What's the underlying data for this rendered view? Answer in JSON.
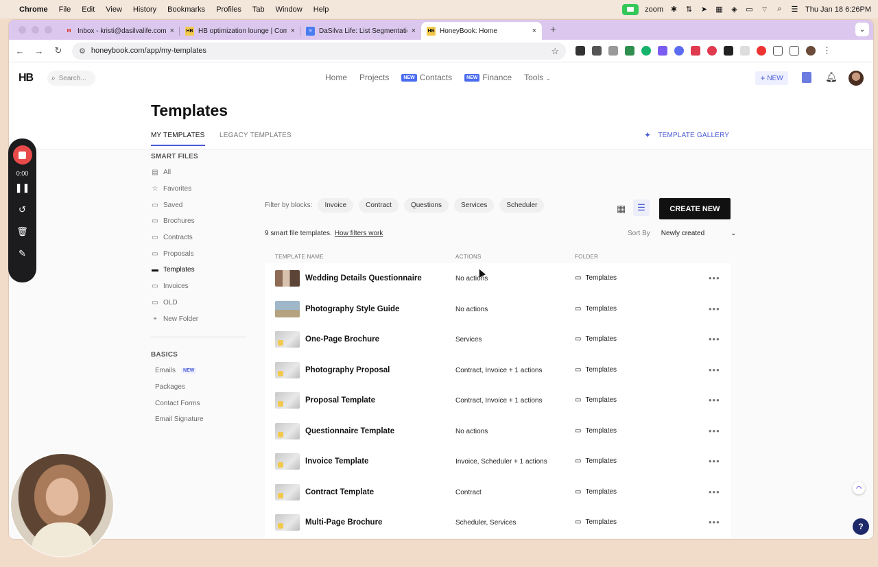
{
  "menubar": {
    "app": "Chrome",
    "items": [
      "File",
      "Edit",
      "View",
      "History",
      "Bookmarks",
      "Profiles",
      "Tab",
      "Window",
      "Help"
    ],
    "zoom_label": "zoom",
    "datetime": "Thu Jan 18  6:26PM"
  },
  "browser": {
    "tabs": [
      {
        "title": "Inbox - kristi@dasilvalife.com",
        "icon": "gmail-icon",
        "color": "#ffffff"
      },
      {
        "title": "HB optimization lounge | Com",
        "icon": "hb-icon",
        "color": "#111111"
      },
      {
        "title": "DaSilva Life: List Segmentatio",
        "icon": "doc-icon",
        "color": "#4a7df0"
      },
      {
        "title": "HoneyBook: Home",
        "icon": "hb-icon",
        "color": "#111111"
      }
    ],
    "url": "honeybook.com/app/my-templates"
  },
  "app": {
    "logo": "HB",
    "search_placeholder": "Search...",
    "nav": [
      {
        "label": "Home",
        "tag": ""
      },
      {
        "label": "Projects",
        "tag": ""
      },
      {
        "label": "Contacts",
        "tag": "NEW"
      },
      {
        "label": "Finance",
        "tag": "NEW"
      },
      {
        "label": "Tools",
        "tag": ""
      }
    ],
    "new_button": "NEW"
  },
  "page": {
    "title": "Templates",
    "tabs": [
      "MY TEMPLATES",
      "LEGACY TEMPLATES"
    ],
    "gallery_label": "TEMPLATE GALLERY"
  },
  "sidebar": {
    "smart_files_heading": "SMART FILES",
    "smart_files": [
      {
        "label": "All",
        "icon": "list-icon"
      },
      {
        "label": "Favorites",
        "icon": "star-icon"
      },
      {
        "label": "Saved",
        "icon": "folder-icon"
      },
      {
        "label": "Brochures",
        "icon": "folder-icon"
      },
      {
        "label": "Contracts",
        "icon": "folder-icon"
      },
      {
        "label": "Proposals",
        "icon": "folder-icon"
      },
      {
        "label": "Templates",
        "icon": "folder-icon"
      },
      {
        "label": "Invoices",
        "icon": "folder-icon"
      },
      {
        "label": "OLD",
        "icon": "folder-icon"
      },
      {
        "label": "New Folder",
        "icon": "plus-icon"
      }
    ],
    "basics_heading": "BASICS",
    "basics": [
      {
        "label": "Emails",
        "tag": "NEW"
      },
      {
        "label": "Packages",
        "tag": ""
      },
      {
        "label": "Contact Forms",
        "tag": ""
      },
      {
        "label": "Email Signature",
        "tag": ""
      }
    ]
  },
  "filters": {
    "label": "Filter by blocks:",
    "chips": [
      "Invoice",
      "Contract",
      "Questions",
      "Services",
      "Scheduler"
    ]
  },
  "create_new": "CREATE NEW",
  "count_text": "9 smart file templates.",
  "how_filters_link": "How filters work",
  "sort": {
    "label": "Sort By",
    "value": "Newly created"
  },
  "table": {
    "headers": [
      "TEMPLATE NAME",
      "ACTIONS",
      "FOLDER"
    ],
    "rows": [
      {
        "name": "Wedding Details Questionnaire",
        "actions": "No actions",
        "folder": "Templates"
      },
      {
        "name": "Photography Style Guide",
        "actions": "No actions",
        "folder": "Templates"
      },
      {
        "name": "One-Page Brochure",
        "actions": "Services",
        "folder": "Templates"
      },
      {
        "name": "Photography Proposal",
        "actions": "Contract, Invoice + 1 actions",
        "folder": "Templates"
      },
      {
        "name": "Proposal Template",
        "actions": "Contract, Invoice + 1 actions",
        "folder": "Templates"
      },
      {
        "name": "Questionnaire Template",
        "actions": "No actions",
        "folder": "Templates"
      },
      {
        "name": "Invoice Template",
        "actions": "Invoice, Scheduler + 1 actions",
        "folder": "Templates"
      },
      {
        "name": "Contract Template",
        "actions": "Contract",
        "folder": "Templates"
      },
      {
        "name": "Multi-Page Brochure",
        "actions": "Scheduler, Services",
        "folder": "Templates"
      }
    ]
  },
  "recorder": {
    "time": "0:00"
  },
  "help_label": "?",
  "colors": {
    "accent": "#4a5bd4",
    "record": "#e84a4a",
    "tabstrip": "#dcc8ee"
  }
}
